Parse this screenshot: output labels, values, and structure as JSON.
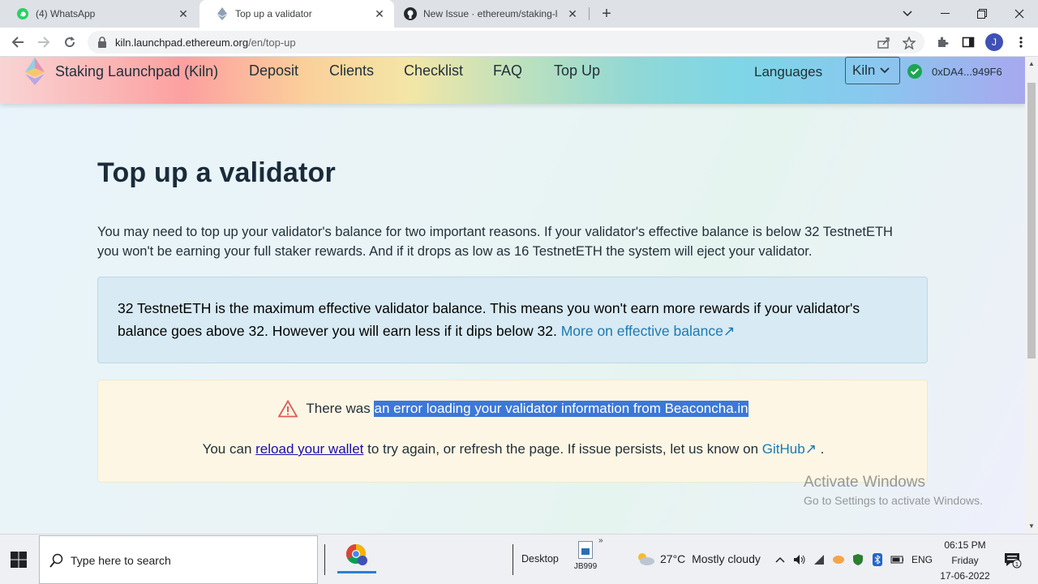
{
  "browser": {
    "tabs": [
      {
        "title": "(4) WhatsApp",
        "icon": "whatsapp-icon",
        "active": false
      },
      {
        "title": "Top up a validator",
        "icon": "ethereum-icon",
        "active": true
      },
      {
        "title": "New Issue · ethereum/staking-lau",
        "icon": "github-icon",
        "active": false
      }
    ],
    "url_host": "kiln.launchpad.ethereum.org",
    "url_path": "/en/top-up",
    "profile_initial": "J"
  },
  "site": {
    "brand": "Staking Launchpad (Kiln)",
    "nav": [
      "Deposit",
      "Clients",
      "Checklist",
      "FAQ",
      "Top Up"
    ],
    "languages": "Languages",
    "network": "Kiln",
    "wallet": "0xDA4...949F6",
    "accent_color": "#1a7ab3"
  },
  "page": {
    "title": "Top up a validator",
    "intro_line1": "You may need to top up your validator's balance for two important reasons. If your validator's effective balance is below 32 TestnetETH",
    "intro_line2": "you won't be earning your full staker rewards. And if it drops as low as 16 TestnetETH the system will eject your validator.",
    "info_line1": "32 TestnetETH is the maximum effective validator balance. This means you won't earn more rewards if your validator's",
    "info_line2": "balance goes above 32. However you will earn less if it dips below 32.",
    "info_link": "More on effective balance↗",
    "error_prefix": "There was",
    "error_selected": "an error loading your validator information from Beaconcha.in",
    "error2_a": "You can",
    "error2_link": "reload your wallet",
    "error2_b": "to try again, or refresh the page. If issue persists, let us know on",
    "error2_gh": "GitHub↗",
    "error2_end": "."
  },
  "watermark": {
    "line1": "Activate Windows",
    "line2": "Go to Settings to activate Windows."
  },
  "taskbar": {
    "search_placeholder": "Type here to search",
    "desktop": "Desktop",
    "file_label": "JB999",
    "temperature": "27°C",
    "weather": "Mostly cloudy",
    "lang": "ENG",
    "time": "06:15 PM",
    "day": "Friday",
    "date": "17-06-2022"
  }
}
